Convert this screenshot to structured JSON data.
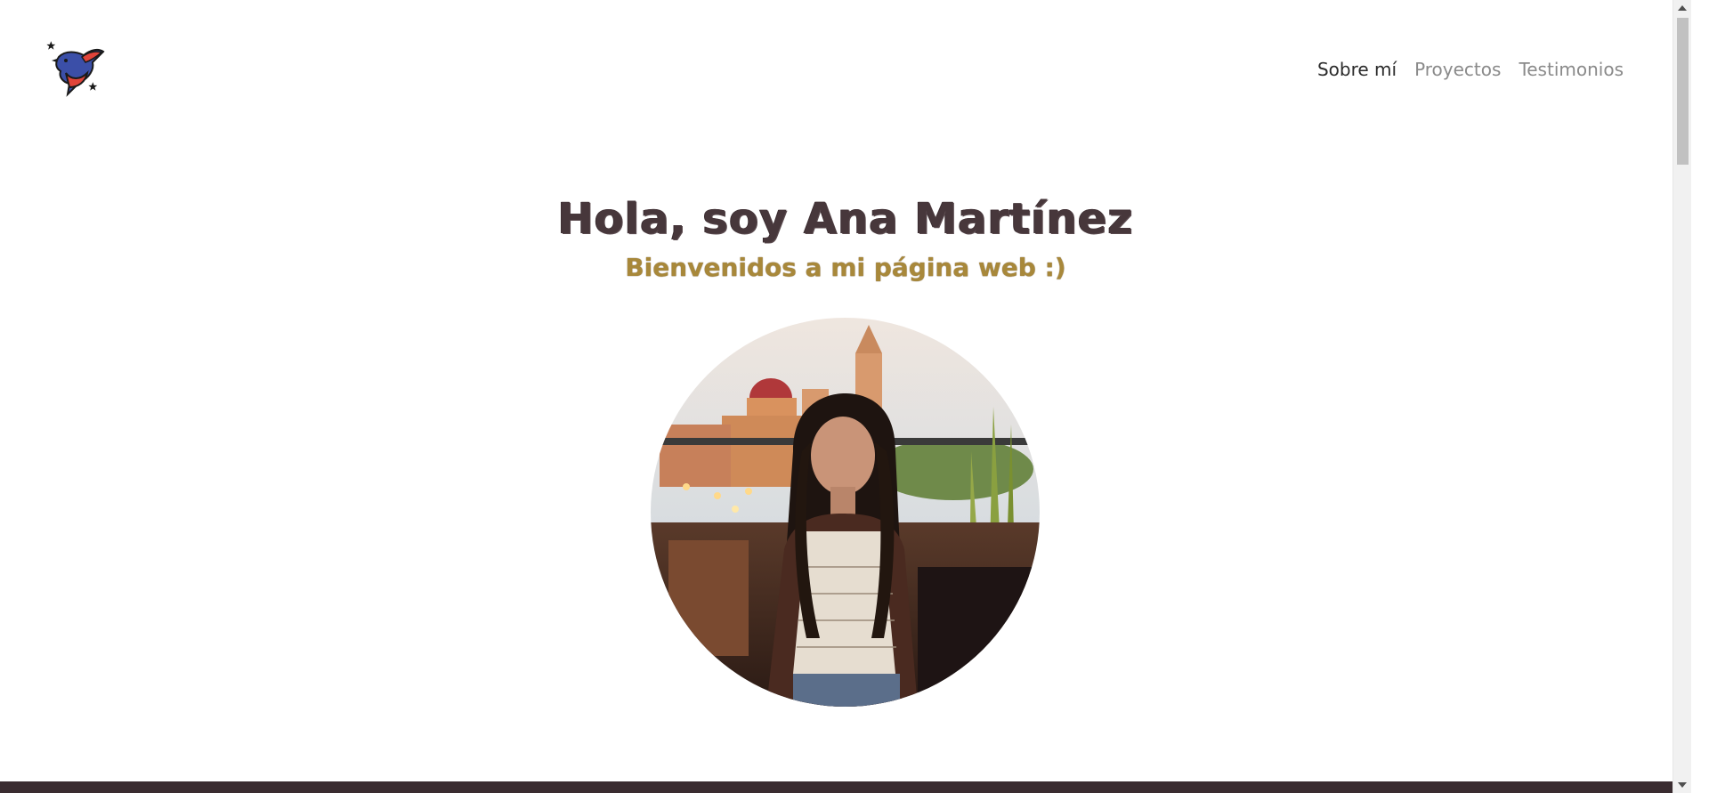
{
  "navbar": {
    "logo": {
      "icon": "swallow-bird-icon",
      "colors": {
        "blue": "#3b4fa8",
        "red": "#e0443a",
        "dark": "#1a1a1a"
      }
    },
    "links": [
      {
        "label": "Sobre mí",
        "active": true
      },
      {
        "label": "Proyectos",
        "active": false
      },
      {
        "label": "Testimonios",
        "active": false
      }
    ]
  },
  "hero": {
    "title": "Hola, soy Ana Martínez",
    "subtitle": "Bienvenidos a mi página web :)",
    "portrait": {
      "icon": "profile-photo"
    }
  },
  "colors": {
    "title": "#47373b",
    "subtitle": "#a8883a",
    "nav_active": "#2b2b2b",
    "nav_inactive": "#8a8a8a",
    "footer_bar": "#3a2c30"
  }
}
